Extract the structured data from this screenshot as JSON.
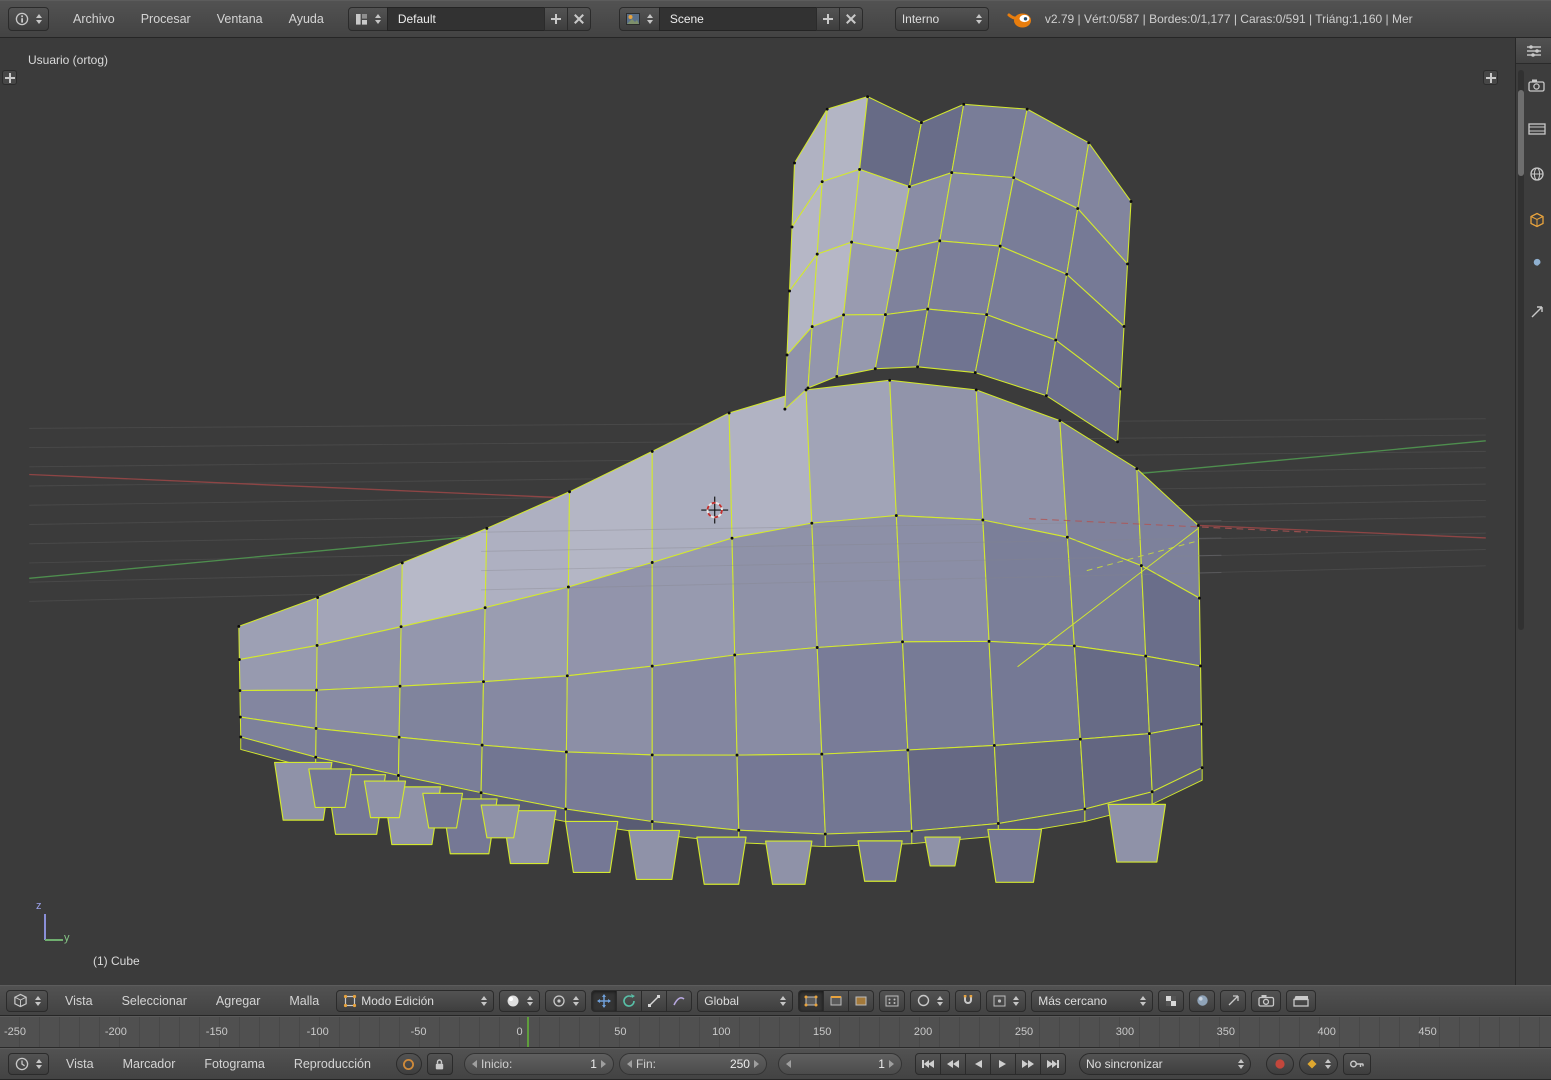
{
  "colors": {
    "edge": "#d3e82f",
    "viewport_bg": "#3b3b3b",
    "grid_line": "#494949",
    "grid_overlay": "#85858d",
    "axis_red": "#8e4545",
    "axis_red_bright": "#b05555",
    "axis_green": "#4e8e4e",
    "vertex": "#0c0c0c",
    "accent_orange": "#e87d0d",
    "record_red": "#c3473c",
    "frame_marker_green": "#5f9e3c",
    "keying_orange": "#dfa72f"
  },
  "top_header": {
    "menus": [
      "Archivo",
      "Procesar",
      "Ventana",
      "Ayuda"
    ],
    "layout_value": "Default",
    "scene_value": "Scene",
    "engine_value": "Interno",
    "stats": "v2.79 | Vért:0/587 | Bordes:0/1,177 | Caras:0/591 | Triáng:1,160 | Mer"
  },
  "viewport": {
    "view_label": "Usuario (ortog)",
    "object_label": "(1) Cube",
    "axis_z_label": "z",
    "axis_y_label": "y"
  },
  "viewport_header": {
    "menus": [
      "Vista",
      "Seleccionar",
      "Agregar",
      "Malla"
    ],
    "mode_value": "Modo Edición",
    "orientation_value": "Global",
    "snap_value": "Más cercano"
  },
  "timeline": {
    "menus": [
      "Vista",
      "Marcador",
      "Fotograma",
      "Reproducción"
    ],
    "ruler_ticks": [
      "-250",
      "-200",
      "-150",
      "-100",
      "-50",
      "0",
      "50",
      "100",
      "150",
      "200",
      "250",
      "300",
      "350",
      "400",
      "450"
    ],
    "start_label": "Inicio:",
    "start_value": "1",
    "end_label": "Fin:",
    "end_value": "250",
    "current_frame": "1",
    "sync_value": "No sincronizar"
  }
}
